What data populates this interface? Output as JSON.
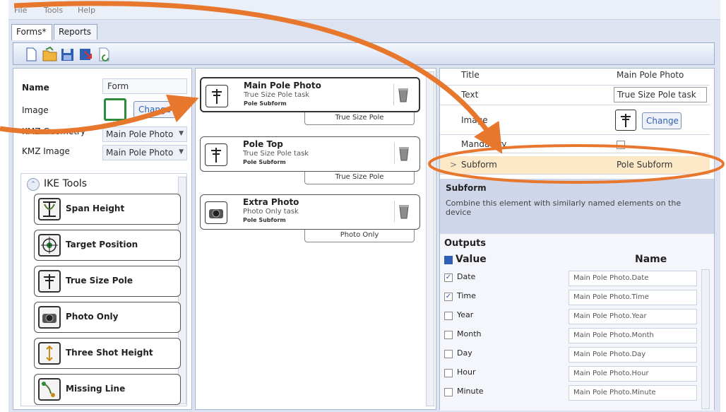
{
  "menu": {
    "file": "File",
    "tools": "Tools",
    "help": "Help"
  },
  "tabs": [
    "Forms*",
    "Reports"
  ],
  "form": {
    "name_label": "Name",
    "name_value": "Form",
    "image_label": "Image",
    "change_label": "Change",
    "kmz_geometry_label": "KMZ Geometry",
    "kmz_geometry_value": "Main Pole Photo",
    "kmz_image_label": "KMZ Image",
    "kmz_image_value": "Main Pole Photo"
  },
  "tools": {
    "header": "IKE Tools",
    "items": [
      {
        "label": "Span Height",
        "icon": "span-height-icon"
      },
      {
        "label": "Target Position",
        "icon": "target-icon"
      },
      {
        "label": "True Size Pole",
        "icon": "pole-icon"
      },
      {
        "label": "Photo Only",
        "icon": "camera-icon"
      },
      {
        "label": "Three Shot Height",
        "icon": "height-arrow-icon"
      },
      {
        "label": "Missing Line",
        "icon": "missing-line-icon"
      }
    ]
  },
  "elements": [
    {
      "title": "Main Pole Photo",
      "task": "True Size Pole task",
      "subform": "Pole Subform",
      "tag": "True Size Pole",
      "icon": "pole-icon"
    },
    {
      "title": "Pole Top",
      "task": "True Size Pole task",
      "subform": "Pole Subform",
      "tag": "True Size Pole",
      "icon": "pole-icon"
    },
    {
      "title": "Extra Photo",
      "task": "Photo Only task",
      "subform": "Pole Subform",
      "tag": "Photo Only",
      "icon": "camera-icon"
    }
  ],
  "properties": [
    {
      "key": "Title",
      "value": "Main Pole Photo"
    },
    {
      "key": "Text",
      "value": "True Size Pole task"
    },
    {
      "key": "Image",
      "value": "Change"
    },
    {
      "key": "Mandatory",
      "value": ""
    },
    {
      "key": "Subform",
      "value": "Pole Subform"
    }
  ],
  "help": {
    "title": "Subform",
    "text": "Combine this element with similarly named elements on the device"
  },
  "outputs": {
    "header": "Outputs",
    "col_value": "Value",
    "col_name": "Name",
    "rows": [
      {
        "label": "Date",
        "checked": true,
        "name": "Main Pole Photo.Date"
      },
      {
        "label": "Time",
        "checked": true,
        "name": "Main Pole Photo.Time"
      },
      {
        "label": "Year",
        "checked": false,
        "name": "Main Pole Photo.Year"
      },
      {
        "label": "Month",
        "checked": false,
        "name": "Main Pole Photo.Month"
      },
      {
        "label": "Day",
        "checked": false,
        "name": "Main Pole Photo.Day"
      },
      {
        "label": "Hour",
        "checked": false,
        "name": "Main Pole Photo.Hour"
      },
      {
        "label": "Minute",
        "checked": false,
        "name": "Main Pole Photo.Minute"
      }
    ]
  },
  "colors": {
    "accent": "#e8772e",
    "highlight_row": "#fde9c8",
    "help_bg": "#cfd6ea"
  }
}
